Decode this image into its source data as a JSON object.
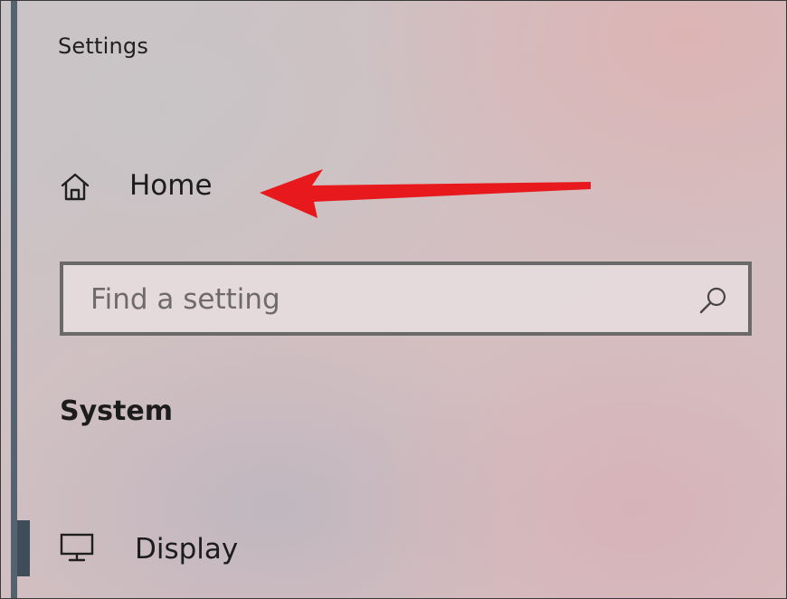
{
  "window": {
    "title": "Settings"
  },
  "nav": {
    "home": {
      "label": "Home",
      "icon": "home-icon"
    },
    "display": {
      "label": "Display",
      "icon": "monitor-icon",
      "selected": true
    }
  },
  "search": {
    "placeholder": "Find a setting",
    "value": "",
    "icon": "search-icon"
  },
  "section": {
    "heading": "System"
  },
  "annotation": {
    "arrow_color": "#e8191c",
    "arrow_points_to": "home"
  },
  "colors": {
    "accent_rail": "#556270",
    "selected_indicator": "#3f4d5b"
  }
}
